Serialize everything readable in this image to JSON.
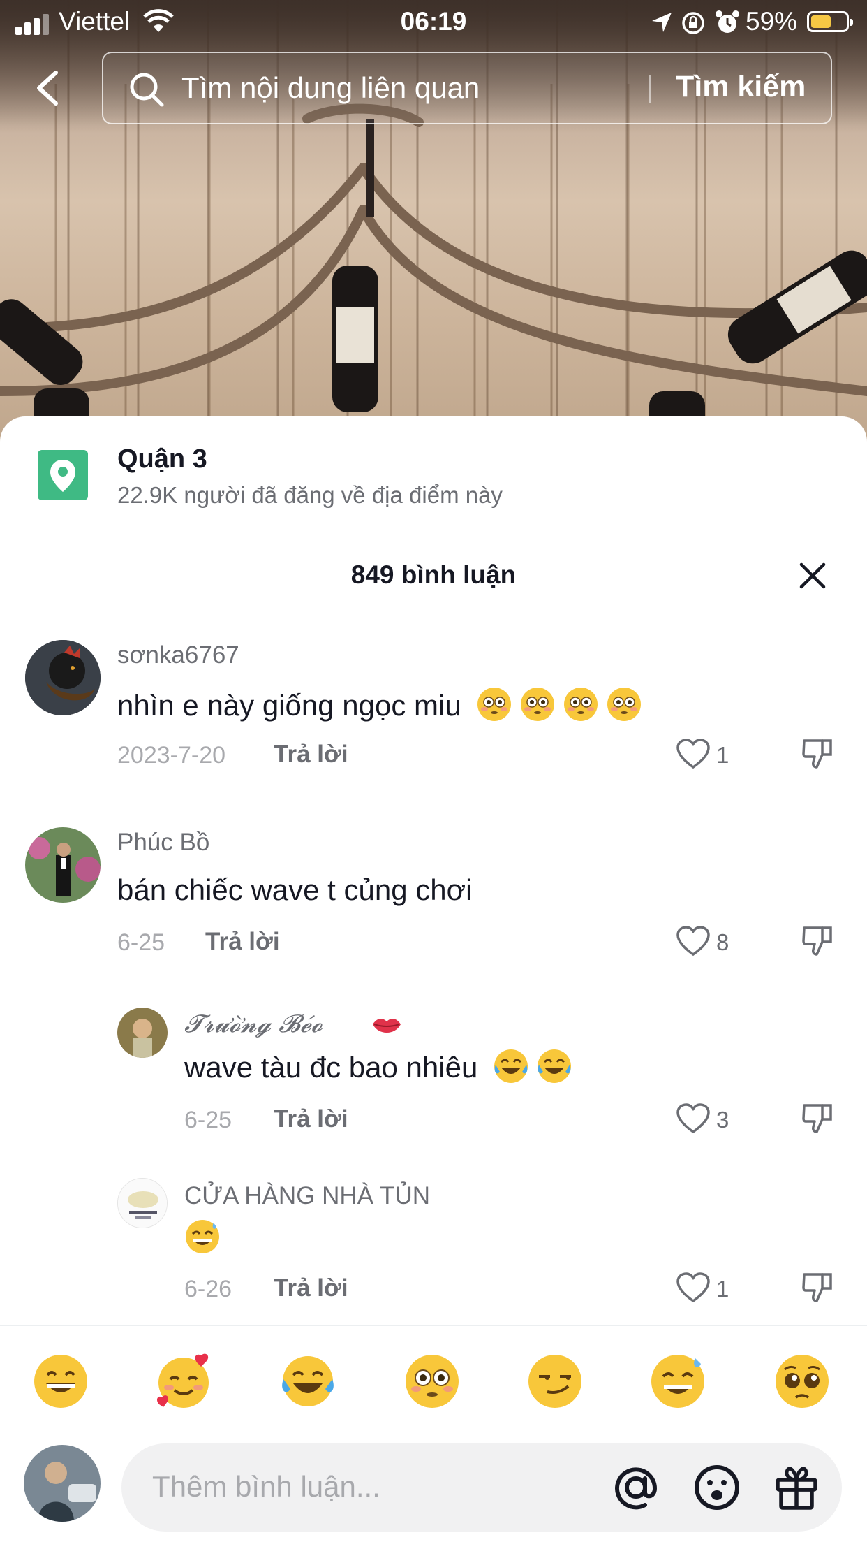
{
  "status_bar": {
    "carrier": "Viettel",
    "time": "06:19",
    "battery": "59%",
    "battery_level": 0.59
  },
  "search": {
    "placeholder": "Tìm nội dung liên quan",
    "button_label": "Tìm kiếm"
  },
  "location": {
    "name": "Quận 3",
    "subtitle": "22.9K người đã đăng về địa điểm này",
    "accent_color": "#3fba84"
  },
  "comments_header": {
    "title": "849 bình luận"
  },
  "comments": [
    {
      "username": "sơnka6767",
      "text": "nhìn e này giống ngọc miu",
      "emojis": [
        "flushed-emoji",
        "flushed-emoji",
        "flushed-emoji",
        "flushed-emoji"
      ],
      "date": "2023-7-20",
      "reply_label": "Trả lời",
      "likes": "1"
    },
    {
      "username": "Phúc Bồ",
      "text": "bán chiếc wave t củng chơi",
      "date": "6-25",
      "reply_label": "Trả lời",
      "likes": "8"
    },
    {
      "username": "𝓣𝓻𝓾̛𝓸̛̀𝓷𝓰 𝓑𝓮́𝓸",
      "text": "wave tàu đc bao nhiêu",
      "emojis": [
        "tears-of-joy-emoji",
        "tears-of-joy-emoji"
      ],
      "date": "6-25",
      "reply_label": "Trả lời",
      "likes": "3",
      "is_reply": true
    },
    {
      "username": "CỬA HÀNG NHÀ TỦN",
      "text": "",
      "emojis": [
        "sweat-smile-emoji"
      ],
      "date": "6-26",
      "reply_label": "Trả lời",
      "likes": "1",
      "is_reply": true
    }
  ],
  "emoji_bar": [
    "grinning-emoji",
    "smiling-hearts-emoji",
    "tears-of-joy-emoji",
    "flushed-emoji",
    "smirk-emoji",
    "sweat-smile-emoji",
    "pleading-emoji"
  ],
  "comment_input": {
    "placeholder": "Thêm bình luận..."
  }
}
